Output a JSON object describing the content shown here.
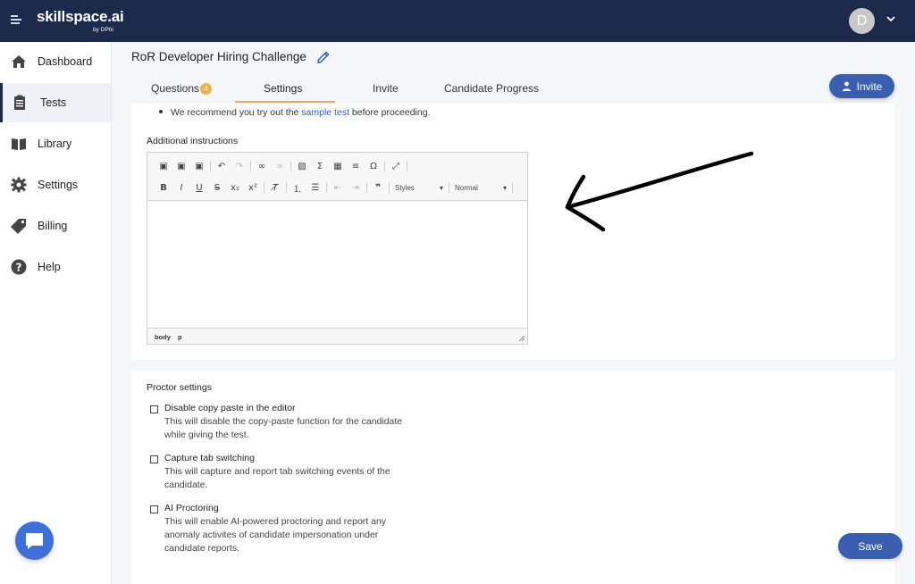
{
  "brand": {
    "name": "skillspace.ai",
    "sub": "by DPhi"
  },
  "user": {
    "initial": "D"
  },
  "sidebar": {
    "items": [
      {
        "label": "Dashboard",
        "icon": "home-icon"
      },
      {
        "label": "Tests",
        "icon": "clipboard-icon",
        "active": true
      },
      {
        "label": "Library",
        "icon": "book-icon"
      },
      {
        "label": "Settings",
        "icon": "gear-icon"
      },
      {
        "label": "Billing",
        "icon": "tag-icon"
      },
      {
        "label": "Help",
        "icon": "question-icon"
      }
    ]
  },
  "header": {
    "title": "RoR Developer Hiring Challenge",
    "tabs": [
      {
        "label": "Questions",
        "badge": "4"
      },
      {
        "label": "Settings",
        "active": true
      },
      {
        "label": "Invite"
      },
      {
        "label": "Candidate Progress"
      }
    ],
    "invite_label": "Invite"
  },
  "recommend": {
    "before": "We recommend you try out the ",
    "link": "sample test",
    "after": " before proceeding."
  },
  "additional_instructions": {
    "label": "Additional instructions",
    "toolbar": {
      "styles_label": "Styles",
      "format_label": "Normal"
    },
    "status": {
      "path1": "body",
      "path2": "p"
    }
  },
  "proctor": {
    "label": "Proctor settings",
    "options": [
      {
        "title": "Disable copy paste in the editor",
        "desc": "This will disable the copy-paste function for the candidate while giving the test."
      },
      {
        "title": "Capture tab switching",
        "desc": "This will capture and report tab switching events of the candidate."
      },
      {
        "title": "AI Proctoring",
        "desc": "This will enable AI-powered proctoring and report any anomaly activites of candidate impersonation under candidate reports."
      }
    ]
  },
  "save_label": "Save",
  "colors": {
    "topbar": "#1b2a4a",
    "primary": "#3b5fb0",
    "badge": "#f0b14a",
    "tab_underline": "#f0a65a",
    "link": "#2f60c0"
  }
}
